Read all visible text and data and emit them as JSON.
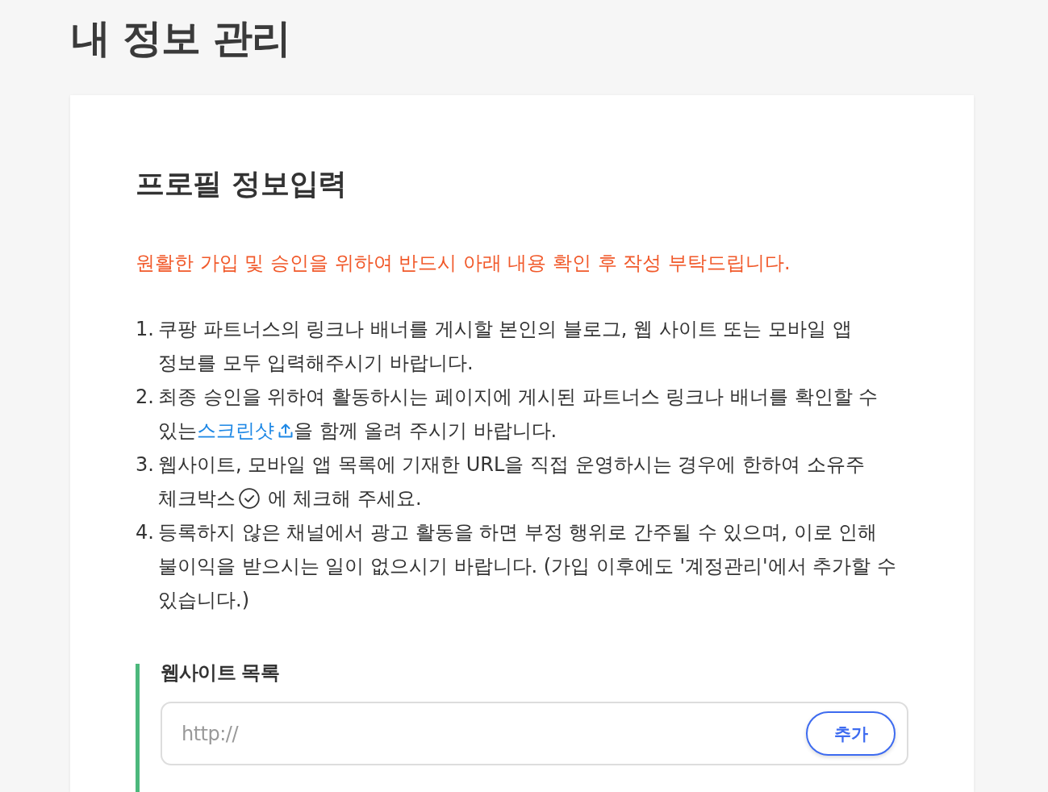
{
  "page_title": "내 정보 관리",
  "card": {
    "title": "프로필 정보입력",
    "notice": "원활한 가입 및 승인을 위하여 반드시 아래 내용 확인 후 작성 부탁드립니다.",
    "steps": [
      {
        "number": "1.",
        "parts": [
          {
            "kind": "text",
            "text": "쿠팡 파트너스의 링크나 배너를 게시할 본인의 블로그, 웹 사이트 또는 모바일 앱 정보를 모두 입력해주시기 바랍니다."
          }
        ]
      },
      {
        "number": "2.",
        "parts": [
          {
            "kind": "text",
            "text": "최종 승인을 위하여 활동하시는 페이지에 게시된 파트너스 링크나 배너를 확인할 수 있는"
          },
          {
            "kind": "link",
            "text": "스크린샷"
          },
          {
            "kind": "text",
            "text": "을 함께 올려 주시기 바랍니다."
          }
        ]
      },
      {
        "number": "3.",
        "parts": [
          {
            "kind": "text",
            "text": "웹사이트, 모바일 앱 목록에 기재한 URL을 직접 운영하시는 경우에 한하여 소유주 체크박스"
          },
          {
            "kind": "mark"
          },
          {
            "kind": "text",
            "text": " 에 체크해 주세요."
          }
        ]
      },
      {
        "number": "4.",
        "parts": [
          {
            "kind": "text",
            "text": "등록하지 않은 채널에서 광고 활동을 하면 부정 행위로 간주될 수 있으며, 이로 인해 불이익을 받으시는 일이 없으시기 바랍니다. (가입 이후에도 '계정관리'에서 추가할 수 있습니다.)"
          }
        ]
      }
    ],
    "website_list": {
      "label": "웹사이트 목록",
      "placeholder": "http://",
      "button": "추가"
    }
  }
}
